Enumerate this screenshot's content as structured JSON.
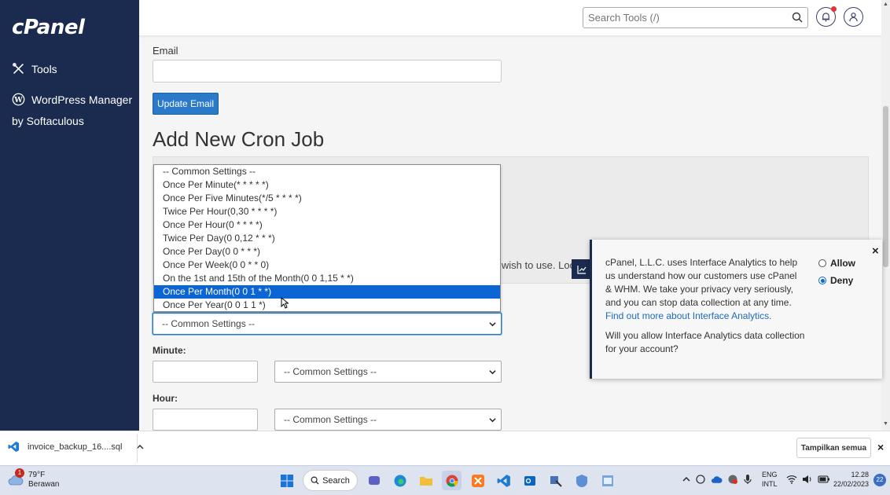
{
  "sidebar": {
    "logo": "cPanel",
    "items": [
      {
        "label": "Tools",
        "icon": "tools-icon"
      },
      {
        "label": "WordPress Manager",
        "icon": "wordpress-icon"
      }
    ],
    "wp_sub": "by Softaculous"
  },
  "topbar": {
    "search_placeholder": "Search Tools (/)"
  },
  "email": {
    "label": "Email",
    "value": "",
    "button": "Update Email"
  },
  "cron": {
    "heading": "Add New Cron Job",
    "info_fragment": "u wish to use. Look",
    "common_select": "-- Common Settings --",
    "dropdown_options": [
      "-- Common Settings --",
      "Once Per Minute(* * * * *)",
      "Once Per Five Minutes(*/5 * * * *)",
      "Twice Per Hour(0,30 * * * *)",
      "Once Per Hour(0 * * * *)",
      "Twice Per Day(0 0,12 * * *)",
      "Once Per Day(0 0 * * *)",
      "Once Per Week(0 0 * * 0)",
      "On the 1st and 15th of the Month(0 0 1,15 * *)",
      "Once Per Month(0 0 1 * *)",
      "Once Per Year(0 0 1 1 *)"
    ],
    "highlighted_option": "Once Per Month(0 0 1 * *)",
    "minute_label": "Minute:",
    "minute_select": "-- Common Settings --",
    "hour_label": "Hour:",
    "hour_select": "-- Common Settings --"
  },
  "analytics_popup": {
    "text_before_link": "cPanel, L.L.C. uses Interface Analytics to help us understand how our customers use cPanel & WHM. We take your privacy very seriously, and you can stop data collection at any time.",
    "link": "Find out more about Interface Analytics.",
    "question": "Will you allow Interface Analytics data collection for your account?",
    "allow_label": "Allow",
    "deny_label": "Deny",
    "selected": "Deny",
    "close": "×"
  },
  "download_bar": {
    "filename": "invoice_backup_16....sql",
    "show_all": "Tampilkan semua",
    "close": "×"
  },
  "taskbar": {
    "weather_temp": "79°F",
    "weather_desc": "Berawan",
    "weather_badge": "1",
    "search_label": "Search",
    "lang_line1": "ENG",
    "lang_line2": "INTL",
    "time": "12.28",
    "date": "22/02/2023",
    "notif_count": "22"
  },
  "colors": {
    "sidebar_bg": "#1b2b4f",
    "accent": "#2a7ac9",
    "highlight": "#0b65d4"
  }
}
